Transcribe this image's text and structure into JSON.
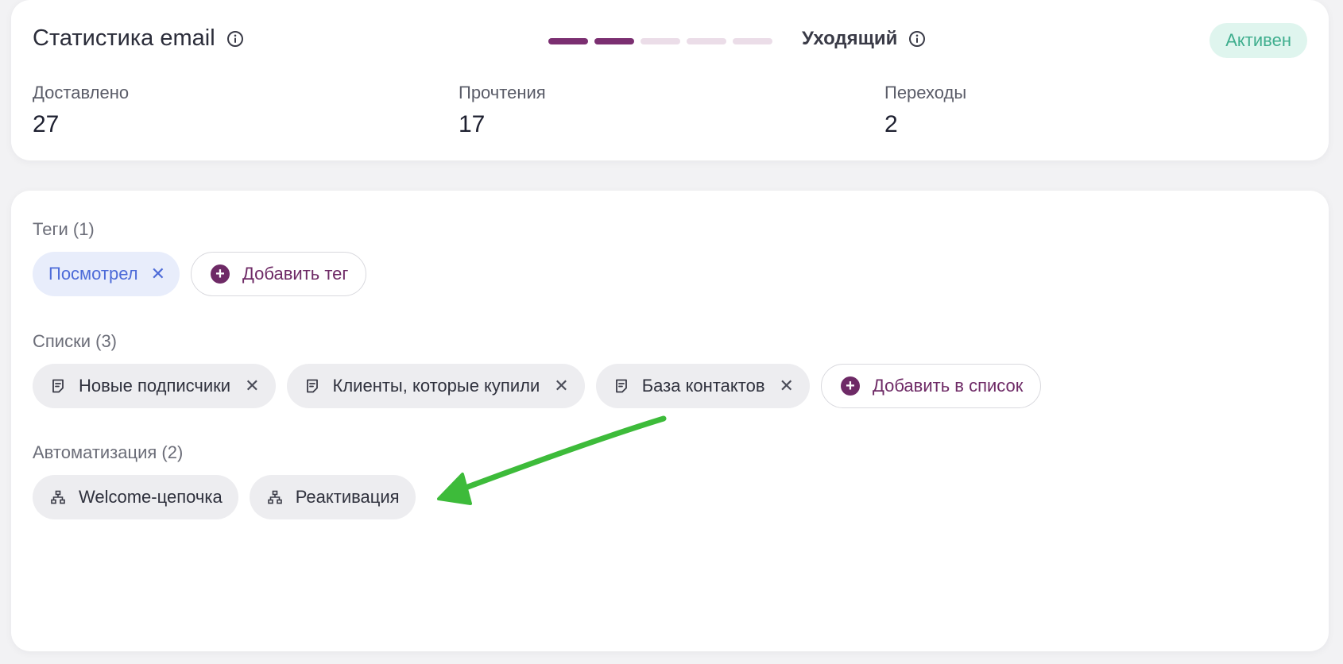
{
  "stats": {
    "title": "Статистика email",
    "direction": "Уходящий",
    "status": "Активен",
    "progress": {
      "filled": 2,
      "total": 5
    },
    "metrics": [
      {
        "label": "Доставлено",
        "value": "27"
      },
      {
        "label": "Прочтения",
        "value": "17"
      },
      {
        "label": "Переходы",
        "value": "2"
      }
    ]
  },
  "tags": {
    "label": "Теги (1)",
    "items": [
      "Посмотрел"
    ],
    "add_label": "Добавить тег"
  },
  "lists": {
    "label": "Списки (3)",
    "items": [
      "Новые подписчики",
      "Клиенты, которые купили",
      "База контактов"
    ],
    "add_label": "Добавить в список"
  },
  "automation": {
    "label": "Автоматизация (2)",
    "items": [
      "Welcome-цепочка",
      "Реактивация"
    ]
  },
  "colors": {
    "accent": "#6e2a66",
    "status_bg": "#dff5ee",
    "status_text": "#3fae8e",
    "tag_bg": "#e8edfb",
    "tag_text": "#4d6bd8",
    "arrow": "#3dbb3a"
  },
  "icons": {
    "info": "info-circle-icon",
    "close": "close-icon",
    "list": "document-icon",
    "automation": "flow-tree-icon",
    "add": "plus-circle-icon"
  }
}
